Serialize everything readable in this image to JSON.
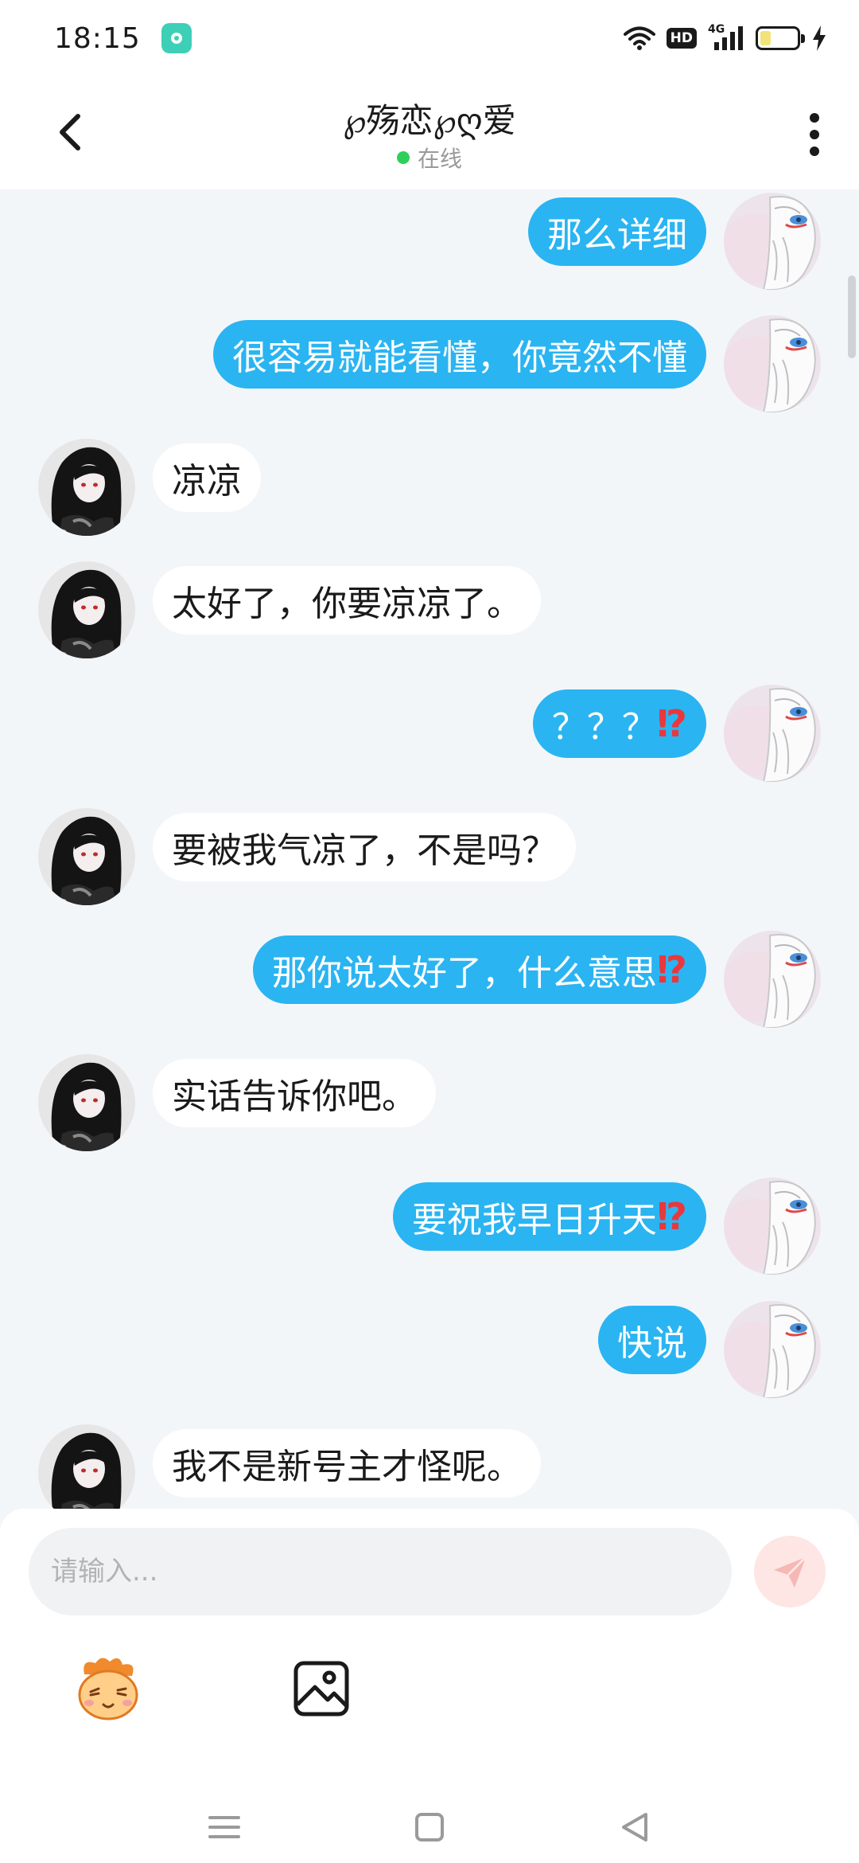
{
  "status_bar": {
    "time": "18:15",
    "hd_badge": "HD",
    "network": "4G",
    "battery_level": 0.3
  },
  "header": {
    "title": "℘殇恋℘ღ爱",
    "online_status": "在线"
  },
  "messages": [
    {
      "side": "out",
      "text": "那么详细"
    },
    {
      "side": "out",
      "text": "很容易就能看懂，你竟然不懂"
    },
    {
      "side": "in",
      "text": "凉凉"
    },
    {
      "side": "in",
      "text": "太好了，你要凉凉了。"
    },
    {
      "side": "out",
      "text": "？？？",
      "emoji": "⁉"
    },
    {
      "side": "in",
      "text": "要被我气凉了，不是吗？"
    },
    {
      "side": "out",
      "text": "那你说太好了，什么意思",
      "emoji": "⁉"
    },
    {
      "side": "in",
      "text": "实话告诉你吧。"
    },
    {
      "side": "out",
      "text": "要祝我早日升天",
      "emoji": "⁉"
    },
    {
      "side": "out",
      "text": "快说"
    },
    {
      "side": "in",
      "text": "我不是新号主才怪呢。"
    }
  ],
  "composer": {
    "placeholder": "请输入...",
    "value": ""
  },
  "icons": {
    "back": "chevron-left-icon",
    "more": "more-vertical-icon",
    "send": "paper-plane-icon",
    "sticker": "sticker-icon",
    "image": "image-icon",
    "nav_menu": "menu-icon",
    "nav_home": "home-square-icon",
    "nav_back": "back-triangle-icon"
  },
  "colors": {
    "outgoing_bubble": "#2ab4f2",
    "incoming_bubble": "#ffffff",
    "online_dot": "#2fcf5b",
    "send_button": "#fde6e4",
    "chat_background": "#f3f6f9"
  }
}
